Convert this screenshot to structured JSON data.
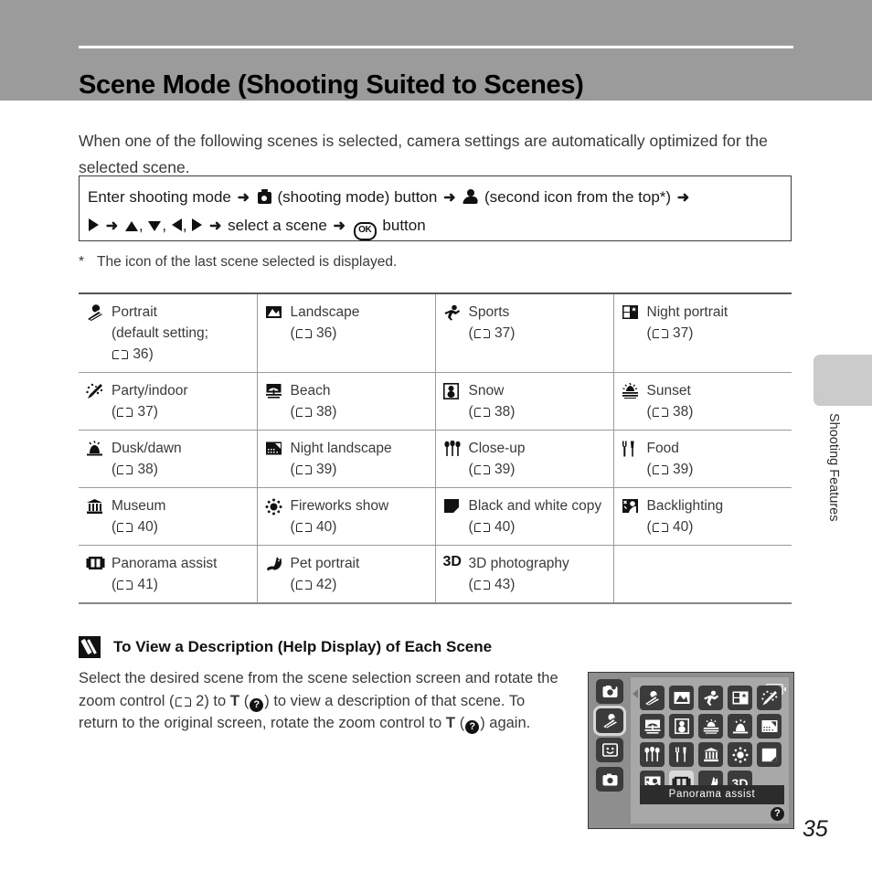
{
  "header": {
    "title": "Scene Mode (Shooting Suited to Scenes)",
    "band_color": "#9b9b9b"
  },
  "intro": {
    "text": "When one of the following scenes is selected, camera settings are automatically optimized for the selected scene."
  },
  "procedure": {
    "line1_a": "Enter shooting mode",
    "line1_b": "(shooting mode) button",
    "line1_c": "(second icon from the top*)",
    "line2_a": "select a scene",
    "line2_b": "button",
    "ok_label": "OK",
    "arrow": "➜"
  },
  "footnote": {
    "marker": "*",
    "text": "The icon of the last scene selected is displayed."
  },
  "scene_table": {
    "rows": [
      [
        {
          "icon": "portrait-icon",
          "name": "Portrait",
          "sub": "(default setting;",
          "sub2_prefix": "(",
          "page": "36",
          "multiline": true
        },
        {
          "icon": "landscape-icon",
          "name": "Landscape",
          "page": "36"
        },
        {
          "icon": "sports-icon",
          "name": "Sports",
          "page": "37"
        },
        {
          "icon": "night-portrait-icon",
          "name": "Night portrait",
          "page": "37"
        }
      ],
      [
        {
          "icon": "party-indoor-icon",
          "name": "Party/indoor",
          "page": "37"
        },
        {
          "icon": "beach-icon",
          "name": "Beach",
          "page": "38"
        },
        {
          "icon": "snow-icon",
          "name": "Snow",
          "page": "38"
        },
        {
          "icon": "sunset-icon",
          "name": "Sunset",
          "page": "38"
        }
      ],
      [
        {
          "icon": "dusk-dawn-icon",
          "name": "Dusk/dawn",
          "page": "38"
        },
        {
          "icon": "night-landscape-icon",
          "name": "Night landscape",
          "page": "39"
        },
        {
          "icon": "close-up-icon",
          "name": "Close-up",
          "page": "39"
        },
        {
          "icon": "food-icon",
          "name": "Food",
          "page": "39"
        }
      ],
      [
        {
          "icon": "museum-icon",
          "name": "Museum",
          "page": "40"
        },
        {
          "icon": "fireworks-icon",
          "name": "Fireworks show",
          "page": "40"
        },
        {
          "icon": "black-white-copy-icon",
          "name": "Black and white copy",
          "page": "40"
        },
        {
          "icon": "backlighting-icon",
          "name": "Backlighting",
          "page": "40"
        }
      ],
      [
        {
          "icon": "panorama-assist-icon",
          "name": "Panorama assist",
          "page": "41"
        },
        {
          "icon": "pet-portrait-icon",
          "name": "Pet portrait",
          "page": "42"
        },
        {
          "icon": "3d-photography-icon",
          "name": "3D photography",
          "page": "43"
        },
        {
          "empty": true
        }
      ]
    ]
  },
  "note": {
    "title": "To View a Description (Help Display) of Each Scene",
    "body_1": "Select the desired scene from the scene selection screen and rotate the zoom control (",
    "body_page_ref": "2",
    "body_2": ") to ",
    "body_t1": "T",
    "body_3": ") to view a description of that scene. To return to the original screen, rotate the zoom control to ",
    "body_t2": "T",
    "body_4": ") again."
  },
  "camera_screen": {
    "rail_icons": [
      "auto-mode-icon",
      "scene-mode-icon",
      "smart-portrait-icon",
      "camera-mode-icon"
    ],
    "rail_active_index": 1,
    "grid_icons": [
      "portrait-icon",
      "landscape-icon",
      "sports-icon",
      "night-portrait-icon",
      "party-indoor-icon",
      "beach-icon",
      "snow-icon",
      "sunset-icon",
      "dusk-dawn-icon",
      "night-landscape-icon",
      "close-up-icon",
      "food-icon",
      "museum-icon",
      "fireworks-icon",
      "black-white-copy-icon",
      "backlighting-icon",
      "panorama-assist-icon",
      "pet-portrait-icon",
      "3d-photography-icon"
    ],
    "selected_index": 16,
    "selected_label": "3D",
    "caption": "Panorama assist",
    "help_glyph": "?"
  },
  "margin": {
    "section_label": "Shooting Features",
    "tab_color": "#cbcbcb"
  },
  "page_number": "35"
}
